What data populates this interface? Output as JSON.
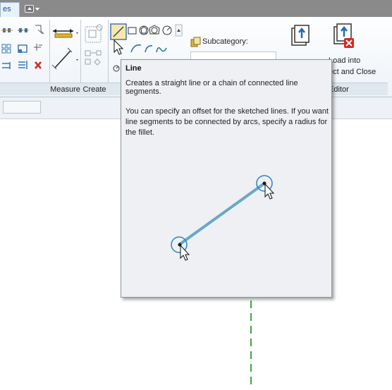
{
  "tabs": {
    "active_label": "es"
  },
  "quick_access": {
    "icon": "visibility-graphics-icon"
  },
  "ribbon": {
    "panels": {
      "measure": "Measure",
      "create": "Create",
      "editor": "Editor"
    },
    "subcategory_label": "Subcategory:",
    "load_into_line1": "Load into",
    "load_into_line2": "ect and Close",
    "colors": {
      "accent": "#1c4f86",
      "green_line": "#3da63d",
      "close_red": "#d02a20"
    }
  },
  "tooltip": {
    "title": "Line",
    "description": "Creates a straight line or a chain of connected line segments.",
    "detail": "You can specify an offset for the sketched lines. If you want line segments to be connected by arcs, specify a radius for the fillet.",
    "illustration": "line-sketch-illustration",
    "colors": {
      "line": "#67a9c7",
      "circle": "#2b84c3"
    }
  }
}
